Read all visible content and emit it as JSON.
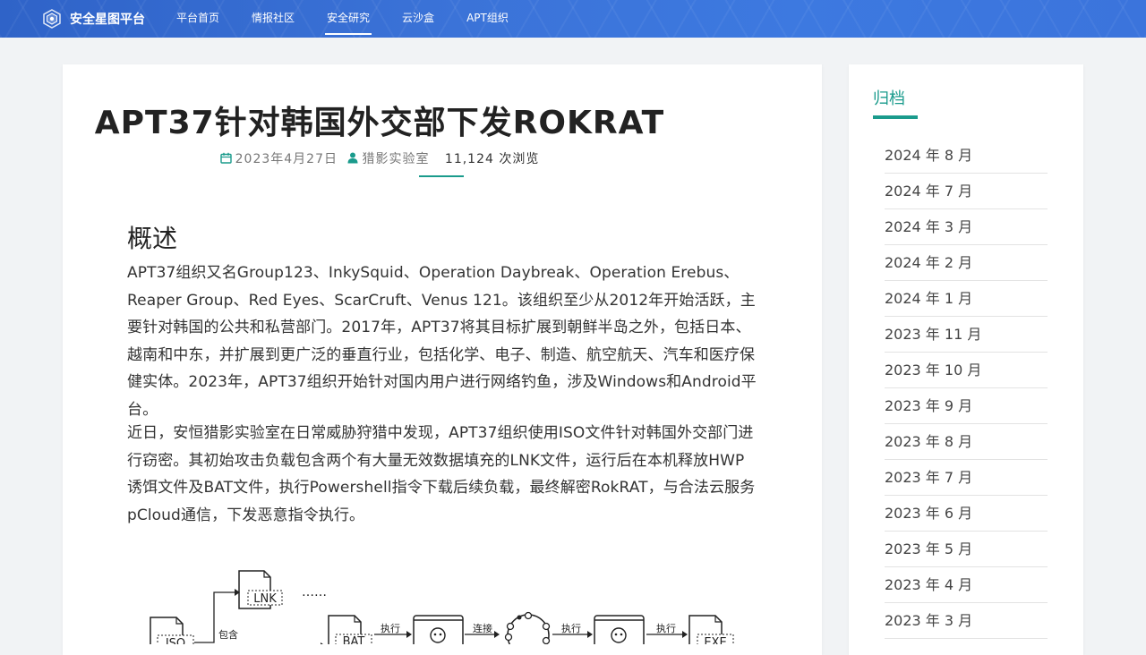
{
  "header": {
    "brand": "安全星图平台",
    "nav": [
      "平台首页",
      "情报社区",
      "安全研究",
      "云沙盒",
      "APT组织"
    ],
    "active_index": 2
  },
  "article": {
    "title": "APT37针对韩国外交部下发ROKRAT",
    "date": "2023年4月27日",
    "author": "猎影实验室",
    "views": "11,124 次浏览",
    "section_title": "概述",
    "paragraph1": "APT37组织又名Group123、InkySquid、Operation Daybreak、Operation Erebus、Reaper Group、Red Eyes、ScarCruft、Venus 121。该组织至少从2012年开始活跃，主要针对韩国的公共和私营部门。2017年，APT37将其目标扩展到朝鲜半岛之外，包括日本、越南和中东，并扩展到更广泛的垂直行业，包括化学、电子、制造、航空航天、汽车和医疗保健实体。2023年，APT37组织开始针对国内用户进行网络钓鱼，涉及Windows和Android平台。",
    "paragraph2": "近日，安恒猎影实验室在日常威胁狩猎中发现，APT37组织使用ISO文件针对韩国外交部门进行窃密。其初始攻击负载包含两个有大量无效数据填充的LNK文件，运行后在本机释放HWP诱饵文件及BAT文件，执行Powershell指令下载后续负载，最终解密RokRAT，与合法云服务pCloud通信，下发恶意指令执行。",
    "diagram": {
      "lnk": "LNK",
      "dots": "……",
      "iso": "ISO",
      "contains": "包含",
      "bat": "BAT",
      "exec1": "执行",
      "connect": "连接",
      "exec2": "执行",
      "exec3": "执行",
      "exe": "EXE"
    }
  },
  "sidebar": {
    "title": "归档",
    "archives": [
      "2024 年 8 月",
      "2024 年 7 月",
      "2024 年 3 月",
      "2024 年 2 月",
      "2024 年 1 月",
      "2023 年 11 月",
      "2023 年 10 月",
      "2023 年 9 月",
      "2023 年 8 月",
      "2023 年 7 月",
      "2023 年 6 月",
      "2023 年 5 月",
      "2023 年 4 月",
      "2023 年 3 月"
    ]
  },
  "colors": {
    "accent": "#1a9b8c",
    "header_blue": "#3b73d8"
  }
}
